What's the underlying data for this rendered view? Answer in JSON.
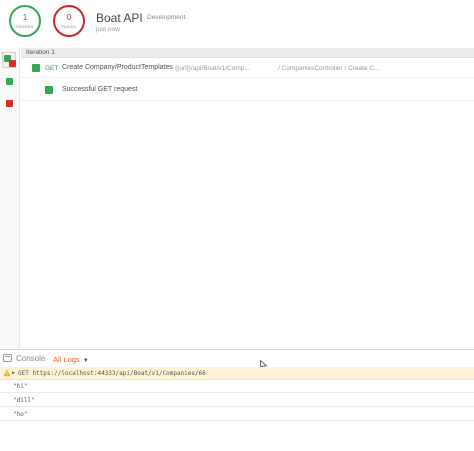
{
  "summary": {
    "passed": {
      "count": "1",
      "label": "PASSED"
    },
    "failed": {
      "count": "0",
      "label": "FAILED"
    },
    "collection": "Boat API",
    "environment": "Development",
    "time": "just now"
  },
  "results": {
    "iteration": "Iteration 1",
    "request": {
      "method": "GET",
      "name": "Create Company/ProductTemplates",
      "url": "{{url}}/api/Boat/v1/Comp...",
      "path": "/ CompaniesController / Create C..."
    },
    "tests": [
      {
        "name": "Successful GET request",
        "status": "pass"
      }
    ]
  },
  "console": {
    "title": "Console",
    "filter": "All Logs",
    "logs": [
      {
        "type": "request",
        "text": "GET https://localhost:44333/api/Boat/v1/Companies/66"
      },
      {
        "type": "value",
        "text": "\"hi\""
      },
      {
        "type": "value",
        "text": "\"dill\""
      },
      {
        "type": "value",
        "text": "\"ho\""
      }
    ]
  },
  "colors": {
    "pass": "#34a853",
    "fail": "#d32f2f",
    "accent": "#e8632a",
    "warning_bg": "#fff3d6"
  }
}
